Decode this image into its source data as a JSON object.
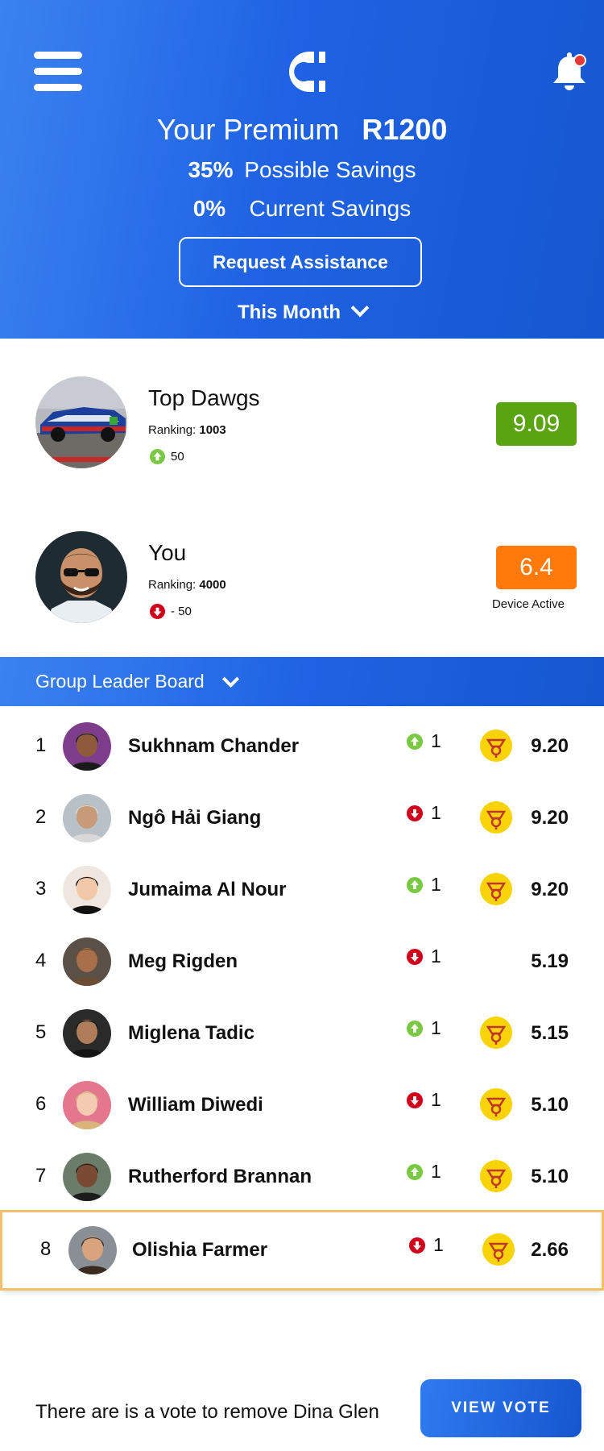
{
  "header": {
    "premium_label": "Your Premium",
    "premium_value": "R1200",
    "possible_savings_pct": "35%",
    "possible_savings_label": "Possible Savings",
    "current_savings_pct": "0%",
    "current_savings_label": "Current Savings",
    "request_button": "Request Assistance",
    "period_selector": "This Month"
  },
  "teams": [
    {
      "name": "Top Dawgs",
      "ranking_label": "Ranking:",
      "ranking": "1003",
      "delta": "50",
      "delta_direction": "up",
      "score": "9.09",
      "score_color": "#5aa412"
    },
    {
      "name": "You",
      "ranking_label": "Ranking:",
      "ranking": "4000",
      "delta": "- 50",
      "delta_direction": "down",
      "score": "6.4",
      "score_color": "#ff7a0a",
      "status": "Device Active"
    }
  ],
  "leaderboard": {
    "title": "Group Leader Board",
    "rows": [
      {
        "rank": "1",
        "name": "Sukhnam Chander",
        "change": "1",
        "direction": "up",
        "badge": true,
        "score": "9.20"
      },
      {
        "rank": "2",
        "name": "Ngô Hải Giang",
        "change": "1",
        "direction": "down",
        "badge": true,
        "score": "9.20"
      },
      {
        "rank": "3",
        "name": "Jumaima Al Nour",
        "change": "1",
        "direction": "up",
        "badge": true,
        "score": "9.20"
      },
      {
        "rank": "4",
        "name": "Meg Rigden",
        "change": "1",
        "direction": "down",
        "badge": false,
        "score": "5.19"
      },
      {
        "rank": "5",
        "name": "Miglena Tadic",
        "change": "1",
        "direction": "up",
        "badge": true,
        "score": "5.15"
      },
      {
        "rank": "6",
        "name": "William Diwedi",
        "change": "1",
        "direction": "down",
        "badge": true,
        "score": "5.10"
      },
      {
        "rank": "7",
        "name": "Rutherford Brannan",
        "change": "1",
        "direction": "up",
        "badge": true,
        "score": "5.10"
      },
      {
        "rank": "8",
        "name": "Olishia Farmer",
        "change": "1",
        "direction": "down",
        "badge": true,
        "score": "2.66",
        "highlight": true
      }
    ]
  },
  "footer": {
    "message": "There are is a vote to remove Dina Glen",
    "button": "VIEW VOTE"
  },
  "colors": {
    "brand_blue": "#1f63e4",
    "up_green": "#7ac943",
    "down_red": "#d0021b",
    "badge_yellow": "#f7d308",
    "notification_dot": "#e53935",
    "highlight_border": "#f0c06a"
  },
  "icons": {
    "menu": "hamburger-menu-icon",
    "logo": "c-logo-icon",
    "notifications": "bell-icon",
    "up": "arrow-up-circle-icon",
    "down": "arrow-down-circle-icon",
    "badge": "horn-badge-icon"
  }
}
